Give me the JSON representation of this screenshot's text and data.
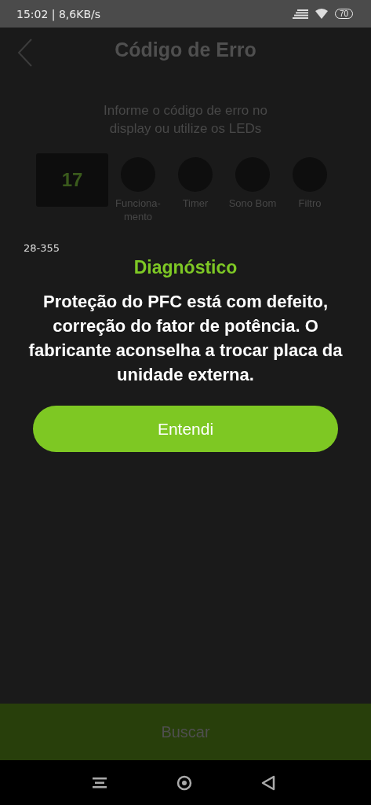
{
  "status_bar": {
    "text": "15:02 | 8,6KB/s",
    "battery": "70"
  },
  "header": {
    "title": "Código de Erro"
  },
  "instruction": "Informe o código de erro no display ou utilize os LEDs",
  "display": {
    "value": "17"
  },
  "leds": [
    {
      "label": "Funciona-mento"
    },
    {
      "label": "Timer"
    },
    {
      "label": "Sono Bom"
    },
    {
      "label": "Filtro"
    }
  ],
  "dialog": {
    "code": "28-355",
    "title": "Diagnóstico",
    "message": "Proteção do PFC está com defeito, correção do fator de potência. O fabricante aconselha a trocar placa da unidade externa.",
    "button": "Entendi"
  },
  "bottom_button": "Buscar"
}
